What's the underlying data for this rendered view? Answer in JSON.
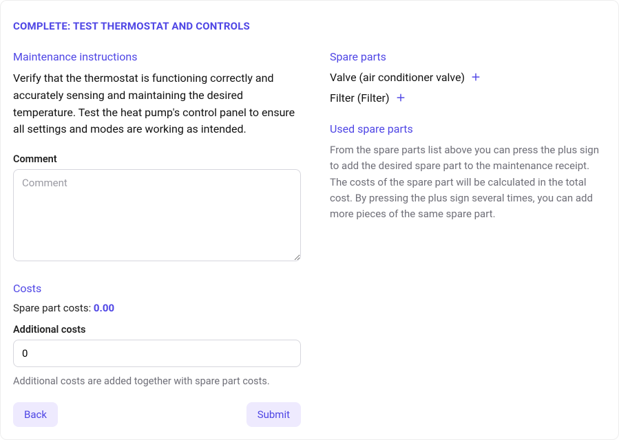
{
  "title": "COMPLETE: TEST THERMOSTAT AND CONTROLS",
  "left": {
    "instructions": {
      "heading": "Maintenance instructions",
      "text": "Verify that the thermostat is functioning correctly and accurately sensing and maintaining the desired temperature. Test the heat pump's control panel to ensure all settings and modes are working as intended."
    },
    "comment": {
      "label": "Comment",
      "placeholder": "Comment",
      "value": ""
    },
    "costs": {
      "heading": "Costs",
      "spare_cost_label": "Spare part costs: ",
      "spare_cost_value": "0.00",
      "additional_label": "Additional costs",
      "additional_value": "0",
      "help": "Additional costs are added together with spare part costs."
    },
    "buttons": {
      "back": "Back",
      "submit": "Submit"
    }
  },
  "right": {
    "spare_parts": {
      "heading": "Spare parts",
      "items": [
        {
          "label": "Valve (air conditioner valve)"
        },
        {
          "label": "Filter (Filter)"
        }
      ]
    },
    "used_spare_parts": {
      "heading": "Used spare parts",
      "text": "From the spare parts list above you can press the plus sign to add the desired spare part to the maintenance receipt. The costs of the spare part will be calculated in the total cost. By pressing the plus sign several times, you can add more pieces of the same spare part."
    }
  }
}
